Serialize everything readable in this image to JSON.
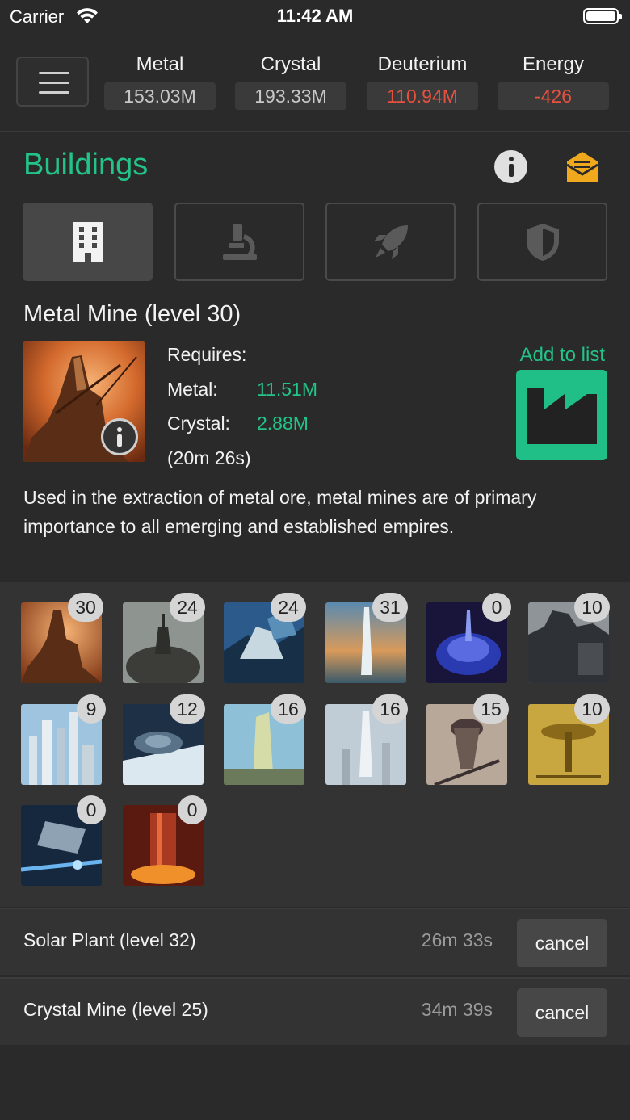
{
  "status_bar": {
    "carrier": "Carrier",
    "time": "11:42 AM"
  },
  "resources": [
    {
      "label": "Metal",
      "value": "153.03M",
      "negative": false
    },
    {
      "label": "Crystal",
      "value": "193.33M",
      "negative": false
    },
    {
      "label": "Deuterium",
      "value": "110.94M",
      "negative": true
    },
    {
      "label": "Energy",
      "value": "-426",
      "negative": true
    }
  ],
  "section": {
    "title": "Buildings"
  },
  "category_tabs": [
    {
      "icon": "building-icon",
      "active": true
    },
    {
      "icon": "microscope-icon",
      "active": false
    },
    {
      "icon": "rocket-icon",
      "active": false
    },
    {
      "icon": "shield-icon",
      "active": false
    }
  ],
  "detail": {
    "title": "Metal Mine (level 30)",
    "requires_label": "Requires:",
    "metal_label": "Metal:",
    "metal_value": "11.51M",
    "crystal_label": "Crystal:",
    "crystal_value": "2.88M",
    "duration": "(20m 26s)",
    "add_to_list": "Add to list",
    "description": "Used in the extraction of metal ore, metal mines are of primary importance to all emerging and established empires."
  },
  "buildings_grid": [
    {
      "level": "30"
    },
    {
      "level": "24"
    },
    {
      "level": "24"
    },
    {
      "level": "31"
    },
    {
      "level": "0"
    },
    {
      "level": "10"
    },
    {
      "level": "9"
    },
    {
      "level": "12"
    },
    {
      "level": "16"
    },
    {
      "level": "16"
    },
    {
      "level": "15"
    },
    {
      "level": "10"
    },
    {
      "level": "0"
    },
    {
      "level": "0"
    }
  ],
  "queue": [
    {
      "name": "Solar Plant (level 32)",
      "time": "26m 33s",
      "action": "cancel"
    },
    {
      "name": "Crystal Mine (level 25)",
      "time": "34m 39s",
      "action": "cancel"
    }
  ],
  "colors": {
    "accent": "#22c48a",
    "negative": "#e8513f",
    "background": "#2a2a2a"
  }
}
